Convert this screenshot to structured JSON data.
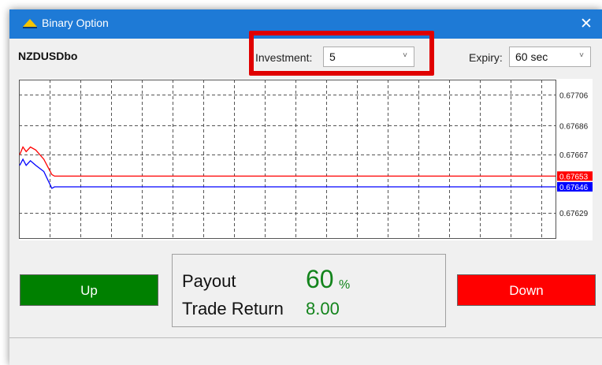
{
  "window": {
    "title": "Binary Option",
    "close_label": "✕"
  },
  "symbol": "NZDUSDbo",
  "investment": {
    "label": "Investment:",
    "value": "5",
    "chevron": "˅"
  },
  "expiry": {
    "label": "Expiry:",
    "value": "60 sec",
    "chevron": "˅"
  },
  "chart_data": {
    "type": "line",
    "y_ticks": [
      "0.67706",
      "0.67686",
      "0.67667",
      "0.67629"
    ],
    "ylim": [
      0.67612,
      0.67716
    ],
    "grid": true,
    "series": [
      {
        "color": "#ff0000",
        "values": [
          0.67667,
          0.67672,
          0.67669,
          0.67672,
          0.6767,
          0.67664,
          0.67654,
          0.67653,
          0.67653
        ]
      },
      {
        "color": "#0000ff",
        "values": [
          0.6766,
          0.67664,
          0.6766,
          0.67663,
          0.6766,
          0.67656,
          0.67645,
          0.67646,
          0.67646
        ]
      }
    ],
    "bid_label": {
      "text": "0.67653",
      "color": "#ff0000"
    },
    "ask_label": {
      "text": "0.67646",
      "color": "#0000ff"
    }
  },
  "up_button": {
    "label": "Up",
    "color": "#008000"
  },
  "down_button": {
    "label": "Down",
    "color": "#ff0000"
  },
  "payout": {
    "label": "Payout",
    "value": "60",
    "unit": "%"
  },
  "trade_return": {
    "label": "Trade Return",
    "value": "8.00"
  },
  "colors": {
    "titlebar": "#1e7ad6",
    "accent_green": "#13841c",
    "highlight_red": "#e00000"
  }
}
